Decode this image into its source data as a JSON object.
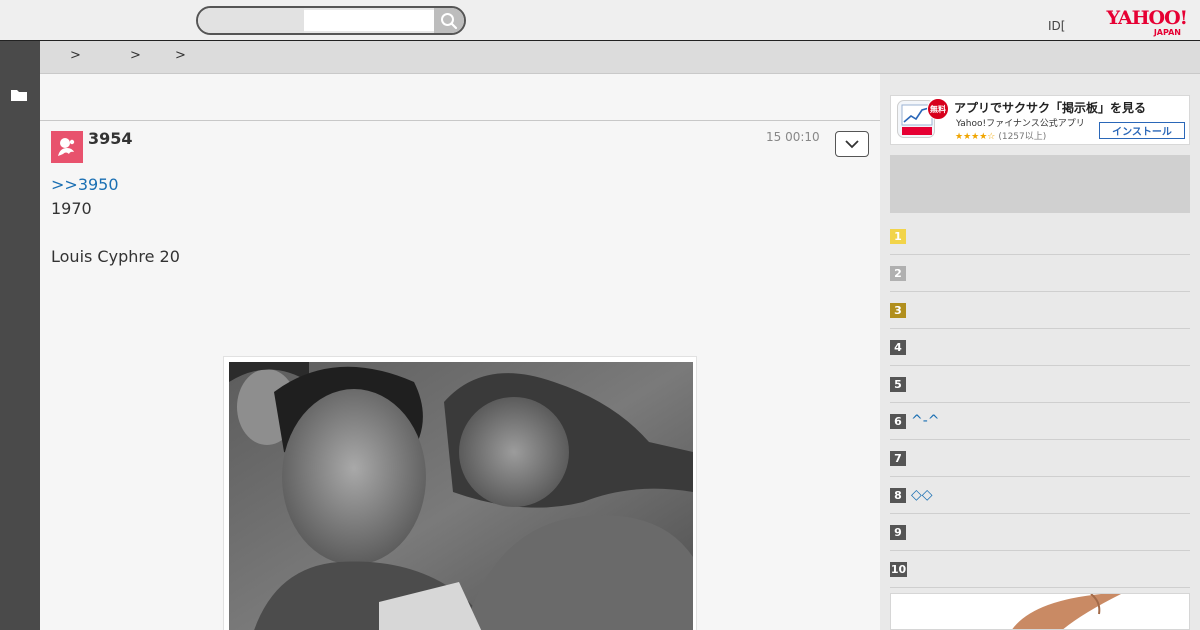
{
  "header": {
    "search_category": "",
    "search_placeholder": "",
    "id_link": "ID[",
    "logo_main": "YAHOO!",
    "logo_sub": "JAPAN"
  },
  "breadcrumb": {
    "separators": [
      ">",
      ">",
      ">"
    ]
  },
  "post": {
    "number": "3954",
    "time": "15 00:10",
    "reply_link": ">>3950",
    "lines": [
      "1970",
      "",
      "Louis Cyphre 20"
    ]
  },
  "app_banner": {
    "free_badge": "無料",
    "title": "アプリでサクサク「掲示板」を見る",
    "subtitle": "Yahoo!ファイナンス公式アプリ",
    "stars": "★★★★☆",
    "review_count": "(1257以上)",
    "install_label": "インストール"
  },
  "ranking": [
    {
      "rank": "1",
      "text": ""
    },
    {
      "rank": "2",
      "text": ""
    },
    {
      "rank": "3",
      "text": ""
    },
    {
      "rank": "4",
      "text": ""
    },
    {
      "rank": "5",
      "text": ""
    },
    {
      "rank": "6",
      "text": "^-^"
    },
    {
      "rank": "7",
      "text": ""
    },
    {
      "rank": "8",
      "text": "◇◇"
    },
    {
      "rank": "9",
      "text": ""
    },
    {
      "rank": "10",
      "text": ""
    }
  ],
  "colors": {
    "brand_red": "#e60033",
    "link_blue": "#1a6fb3",
    "avatar_pink": "#e8526d",
    "rank_gold": "#f2d44a",
    "rank_silver": "#b0b0b0",
    "rank_bronze": "#b18f1e"
  },
  "icons": {
    "search": "search-icon",
    "folder": "folder-icon",
    "dropdown": "chevron-down-icon",
    "avatar": "user-avatar-icon",
    "app": "chart-app-icon"
  }
}
